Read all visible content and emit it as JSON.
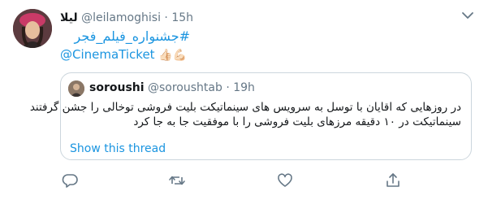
{
  "tweet": {
    "display_name": "لیلا",
    "handle": "@leilamoghisi",
    "sep": "·",
    "time": "15h",
    "hashtag": "#جشنواره_فیلم_فجر",
    "mention": "@CinemaTicket",
    "emojis": "👍🏻💪🏻"
  },
  "quoted": {
    "display_name": "soroushi",
    "handle": "@soroushtab",
    "sep": "·",
    "time": "19h",
    "lines": [
      "در روزهایی که اقایان با توسل به سرویس های سینماتیکت بلیت فروشی توخالی را جشن گرفتند",
      "سینماتیکت در ۱۰ دقیقه  مرزهای بلیت فروشی را با موفقیت جا به جا کرد"
    ],
    "thread_link": "Show this thread"
  },
  "icons": {
    "more": "chevron-down-icon",
    "reply": "reply-icon",
    "retweet": "retweet-icon",
    "like": "heart-icon",
    "share": "share-icon"
  },
  "colors": {
    "link": "#1b95e0",
    "muted": "#657786",
    "border": "#ccd6dd"
  }
}
